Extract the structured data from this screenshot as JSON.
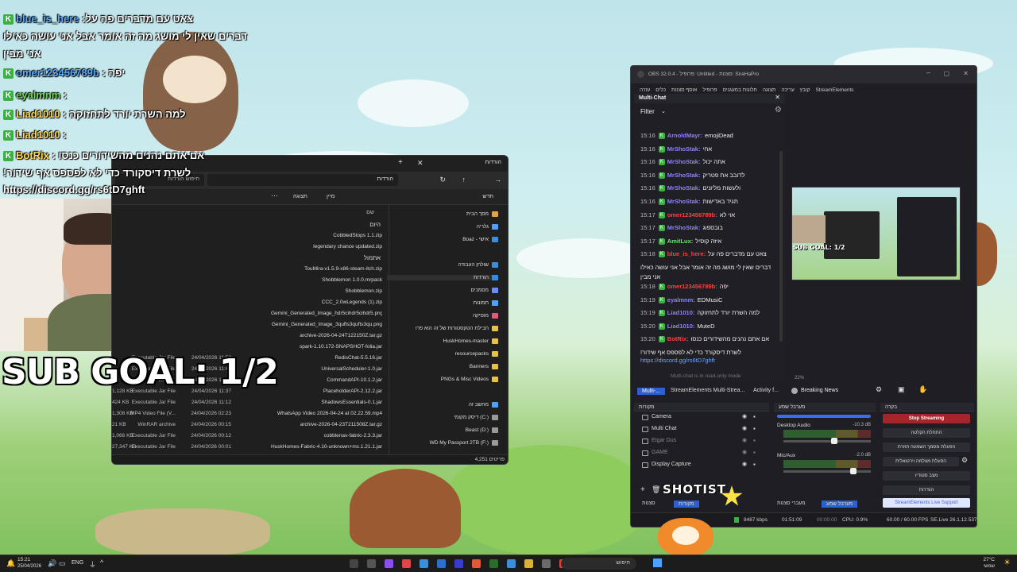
{
  "chat_overlay": {
    "lines": [
      {
        "user": "blue_is_here",
        "text": ":צאט עם מדברים פה על",
        "color": "blue"
      },
      {
        "user": "",
        "text": "דברים שאין לי מושג מה זה אומר אבל אני עושה כאילו",
        "color": ""
      },
      {
        "user": "",
        "text": "אני מבין",
        "color": ""
      },
      {
        "user": "omer123456789b",
        "text": ": יפה",
        "color": "blue"
      },
      {
        "user": "eyalmnm",
        "text": ":",
        "color": "green"
      },
      {
        "user": "Liad1010",
        "text": ": למה השרת יורד לתחזוקה",
        "color": "yellow"
      },
      {
        "user": "Liad1010",
        "text": ":",
        "color": "yellow"
      },
      {
        "user": "BotRix",
        "text": ": אם אתם נהנים מהשידורים כנסו",
        "color": "yellow"
      },
      {
        "user": "",
        "text": "!לשרת דיסקורד כדי לא לפספס אף שידור",
        "color": ""
      },
      {
        "user": "",
        "text": "https://discord.gg/rs6tD7ghft",
        "color": ""
      }
    ]
  },
  "sub_goal": "SUB GOAL: 1/2",
  "explorer": {
    "tab_title": "הורדות",
    "breadcrumb": "הורדות",
    "search_placeholder": "חיפוש הורדות",
    "toolbar": {
      "new": "חדש",
      "sort": "מיין",
      "view": "תצוגה"
    },
    "column_name": "שם",
    "group_today": "היום",
    "group_yesterday": "אתמול",
    "status": "4,251 פריטים",
    "sidebar": [
      {
        "label": "מסך הבית",
        "color": "#e8a23a"
      },
      {
        "label": "גלריה",
        "color": "#4aa3ff"
      },
      {
        "label": "Boaz - אישי",
        "color": "#3a8fd8"
      },
      {
        "label": "שולחן העבודה",
        "color": "#3a8fd8"
      },
      {
        "label": "הורדות",
        "color": "#2e8fe0"
      },
      {
        "label": "מסמכים",
        "color": "#6b8cff"
      },
      {
        "label": "תמונות",
        "color": "#4aa3ff"
      },
      {
        "label": "מוסיקה",
        "color": "#e05a7a"
      },
      {
        "label": "חבילת הטקסטורות של זה הוא פרו",
        "color": "#e8c23a"
      },
      {
        "label": "HuskHomes-master",
        "color": "#e8c23a"
      },
      {
        "label": "resourcepacks",
        "color": "#e8c23a"
      },
      {
        "label": "Banners",
        "color": "#e8c23a"
      },
      {
        "label": "PNGs & Misc Videos",
        "color": "#e8c23a"
      },
      {
        "label": "מחשב זה",
        "color": "#4aa3ff"
      },
      {
        "label": "דיסק מקומי (C:)",
        "color": "#999999"
      },
      {
        "label": "Beast (D:)",
        "color": "#999999"
      },
      {
        "label": "WD My Passport 2TB (F:)",
        "color": "#999999"
      }
    ],
    "files": [
      {
        "name": "CobbledStops 1.1.zip",
        "date": "",
        "type": "",
        "size": ""
      },
      {
        "name": "legendary chance updated.zip",
        "date": "",
        "type": "",
        "size": ""
      },
      {
        "name": "TouMira-v1.5.9-x86-steam-itch.zip",
        "date": "",
        "type": "",
        "size": ""
      },
      {
        "name": "Shobblemon 1.0.0.mrpack",
        "date": "",
        "type": "",
        "size": ""
      },
      {
        "name": "Shobblemon.zip",
        "date": "",
        "type": "",
        "size": ""
      },
      {
        "name": "CCC_2.0wLegends (1).zip",
        "date": "",
        "type": "",
        "size": ""
      },
      {
        "name": "Gemini_Generated_Image_hdr5cihdr5cihdr5.png",
        "date": "",
        "type": "",
        "size": ""
      },
      {
        "name": "Gemini_Generated_Image_3qufts3qufts3qu.png",
        "date": "",
        "type": "",
        "size": ""
      },
      {
        "name": "archive-2026-04-24T122150Z.tar.gz",
        "date": "",
        "type": "",
        "size": ""
      },
      {
        "name": "spark-1.10.172-SNAPSHOT-folia.jar",
        "date": "",
        "type": "",
        "size": ""
      },
      {
        "name": "RedisChat-5.5.16.jar",
        "date": "24/04/2026 11:52",
        "type": "Executable Jar File",
        "size": ""
      },
      {
        "name": "UniversalScheduler-1.0.jar",
        "date": "24/04/2026 11:49",
        "type": "Executable Jar File",
        "size": ""
      },
      {
        "name": "CommandAPI-10.1.2.jar",
        "date": "24/04/2026 11:31",
        "type": "Executable Jar File",
        "size": ""
      },
      {
        "name": "PlaceholderAPI-2.12.2.jar",
        "date": "24/04/2026 11:37",
        "type": "Executable Jar File",
        "size": "1,128 KB"
      },
      {
        "name": "ShadowsEssentials-0.1.jar",
        "date": "24/04/2026 11:12",
        "type": "Executable Jar File",
        "size": "424 KB"
      },
      {
        "name": "WhatsApp Video 2026-04-24 at 02.22.59.mp4",
        "date": "24/04/2026 02:23",
        "type": "MP4 Video File (V...",
        "size": "1,308 KB"
      },
      {
        "name": "archive-2026-04-23T211508Z.tar.gz",
        "date": "24/04/2026 00:15",
        "type": "WinRAR archive",
        "size": "21 KB"
      },
      {
        "name": "cobblenav-fabric-2.3.3.jar",
        "date": "24/04/2026 00:12",
        "type": "Executable Jar File",
        "size": "1,066 KB"
      },
      {
        "name": "HuskHomes-Fabric-4.10-unknown+mc.1.21.1.jar",
        "date": "24/04/2026 00:01",
        "type": "Executable Jar File",
        "size": "27,347 KB"
      }
    ]
  },
  "obs": {
    "title": "OBS 32.0.4 - פרופיל: Untitled - סצנות: SiraHaPro",
    "menu": [
      "קובץ",
      "עריכה",
      "תצוגה",
      "חלונות במעגנים",
      "פרופיל",
      "אוסף סצנות",
      "כלים",
      "עזרה",
      "StreamElements"
    ],
    "multichat_title": "Multi-Chat",
    "filter_label": "Filter",
    "messages": [
      {
        "time": "15:16",
        "user": "ArnoldMayr:",
        "text": "emojiDead",
        "color": "purple"
      },
      {
        "time": "15:16",
        "user": "MrShoStak:",
        "text": "אחי",
        "color": "purple"
      },
      {
        "time": "15:16",
        "user": "MrShoStak:",
        "text": "אתה יכול",
        "color": "purple"
      },
      {
        "time": "15:16",
        "user": "MrShoStak:",
        "text": "לדובב את פטריק",
        "color": "purple"
      },
      {
        "time": "15:16",
        "user": "MrShoStak:",
        "text": "ולעשות מליונים",
        "color": "purple"
      },
      {
        "time": "15:16",
        "user": "MrShoStak:",
        "text": "תגיד באדישות",
        "color": "purple"
      },
      {
        "time": "15:17",
        "user": "omer123456789b:",
        "text": "אוי לא",
        "color": "red"
      },
      {
        "time": "15:17",
        "user": "MrShoStak:",
        "text": "בובספוג",
        "color": "purple"
      },
      {
        "time": "15:17",
        "user": "AmitLux:",
        "text": "איזה קוסיל",
        "color": "green"
      },
      {
        "time": "15:18",
        "user": "blue_is_here:",
        "text": "צאט עם מדברים פה על",
        "color": "red"
      },
      {
        "time": "",
        "user": "",
        "text": "דברים שאין לי מושג מה זה אומר אבל אני עושה כאילו",
        "color": ""
      },
      {
        "time": "",
        "user": "",
        "text": "אני מבין",
        "color": ""
      },
      {
        "time": "15:18",
        "user": "omer123456789b:",
        "text": "יפה",
        "color": "red"
      },
      {
        "time": "15:19",
        "user": "eyalmnm:",
        "text": "EDMusiC",
        "color": "purple"
      },
      {
        "time": "15:19",
        "user": "Liad1010:",
        "text": "למה השרת יורד לתחזוקה",
        "color": "purple"
      },
      {
        "time": "15:20",
        "user": "Liad1010:",
        "text": "MuteD",
        "color": "purple"
      },
      {
        "time": "15:20",
        "user": "BotRix:",
        "text": "אם אתם נהנים מהשידורים כנסו",
        "color": "red"
      },
      {
        "time": "",
        "user": "",
        "text": "!לשרת דיסקורד כדי לא לפספס אף שידור",
        "color": ""
      }
    ],
    "link": "https://discord.gg/rs6tD7ghft",
    "readonly_note": "Multi-chat is in read-only mode",
    "tabs": [
      "Multi-...",
      "StreamElements Multi-Strea...",
      "Activity f..."
    ],
    "breaking_news": "Breaking News",
    "preview_goal": "SUB GOAL: 1/2",
    "zoom": "22%",
    "sources_title": "מקורות",
    "sources": [
      "Camera",
      "Multi Chat",
      "Etgar Dus",
      "GAME",
      "Display Capture"
    ],
    "mixer_title": "מערבל שמע",
    "mixer": [
      {
        "name": "Desktop Audio",
        "db": "-10.3 dB"
      },
      {
        "name": "Mic/Aux",
        "db": "-2.0 dB"
      }
    ],
    "controls_title": "בקרה",
    "controls": [
      "Stop Streaming",
      "התחלת הקלטה",
      "הפעלת מסמך השמעה חוזרת",
      "הפעלת מצלמה וירטואלית",
      "מצב סטודיו",
      "הגדרות",
      "StreamElements Live Support"
    ],
    "dock_tabs": [
      "סצנות",
      "מקורות"
    ],
    "mixer_tabs": [
      "מעברי סצנות",
      "מערבל שמע"
    ],
    "shotist": "SHOTIST",
    "status": {
      "bitrate": "8487 kbps",
      "time": "01:51:09",
      "rec": "00:00:00",
      "cpu": "CPU: 0.9%",
      "fps": "60.00 / 60.00 FPS",
      "version": "SE.Live 26.1.12.537"
    }
  },
  "taskbar": {
    "time": "15:21",
    "date": "25/04/2026",
    "lang": "ENG",
    "search": "חיפוש",
    "weather_temp": "27°C",
    "weather_text": "שמשי"
  }
}
